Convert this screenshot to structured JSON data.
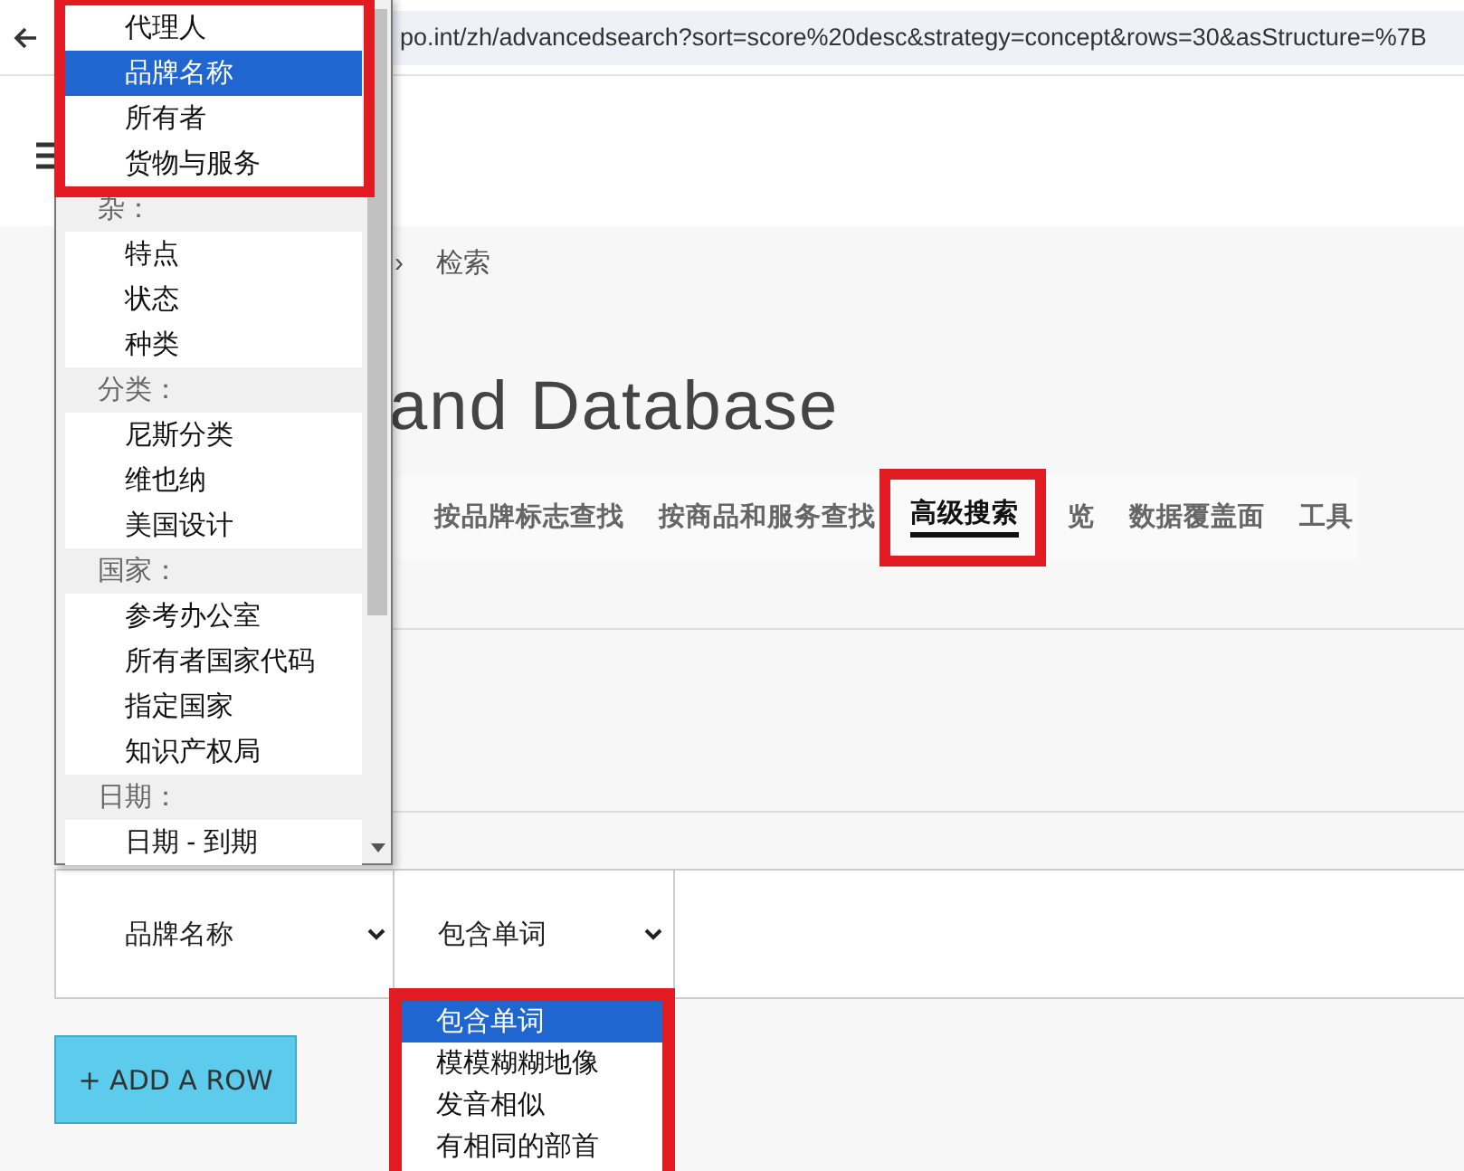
{
  "browser": {
    "url": "po.int/zh/advancedsearch?sort=score%20desc&strategy=concept&rows=30&asStructure=%7B"
  },
  "breadcrumb": {
    "separator": "›",
    "current": "检索"
  },
  "title": "and Database",
  "tabs": [
    {
      "label": "按品牌标志查找",
      "selected": false
    },
    {
      "label": "按商品和服务查找",
      "selected": false
    },
    {
      "label": "高级搜索",
      "selected": true
    },
    {
      "label": "览",
      "selected": false
    },
    {
      "label": "数据覆盖面",
      "selected": false
    },
    {
      "label": "工具",
      "selected": false
    }
  ],
  "field_list": [
    {
      "kind": "option",
      "label": "代理人",
      "selected": false
    },
    {
      "kind": "option",
      "label": "品牌名称",
      "selected": true
    },
    {
      "kind": "option",
      "label": "所有者",
      "selected": false
    },
    {
      "kind": "option",
      "label": "货物与服务",
      "selected": false
    },
    {
      "kind": "group",
      "label": "杂："
    },
    {
      "kind": "option",
      "label": "特点",
      "selected": false
    },
    {
      "kind": "option",
      "label": "状态",
      "selected": false
    },
    {
      "kind": "option",
      "label": "种类",
      "selected": false
    },
    {
      "kind": "group",
      "label": "分类："
    },
    {
      "kind": "option",
      "label": "尼斯分类",
      "selected": false
    },
    {
      "kind": "option",
      "label": "维也纳",
      "selected": false
    },
    {
      "kind": "option",
      "label": "美国设计",
      "selected": false
    },
    {
      "kind": "group",
      "label": "国家："
    },
    {
      "kind": "option",
      "label": "参考办公室",
      "selected": false
    },
    {
      "kind": "option",
      "label": "所有者国家代码",
      "selected": false
    },
    {
      "kind": "option",
      "label": "指定国家",
      "selected": false
    },
    {
      "kind": "option",
      "label": "知识产权局",
      "selected": false
    },
    {
      "kind": "group",
      "label": "日期："
    },
    {
      "kind": "option",
      "label": "日期 - 到期",
      "selected": false
    }
  ],
  "search_row": {
    "field": "品牌名称",
    "operator": "包含单词"
  },
  "operator_list": [
    {
      "label": "包含单词",
      "selected": true
    },
    {
      "label": "模模糊糊地像",
      "selected": false
    },
    {
      "label": "发音相似",
      "selected": false
    },
    {
      "label": "有相同的部首",
      "selected": false
    }
  ],
  "add_row_button": "+ ADD A ROW"
}
